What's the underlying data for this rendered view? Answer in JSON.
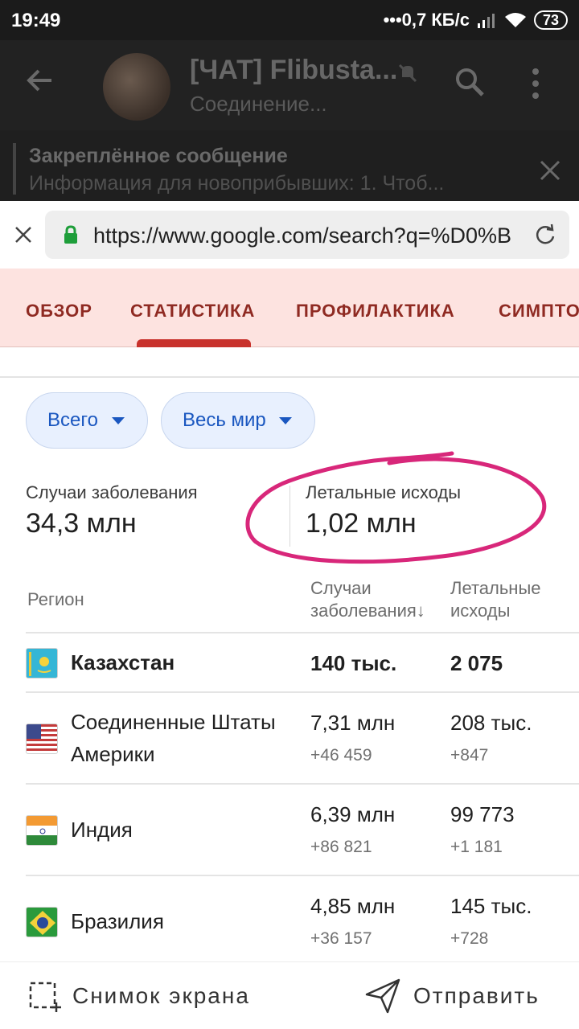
{
  "status": {
    "time": "19:49",
    "network": "•••0,7 КБ/с",
    "battery": "73"
  },
  "telegram": {
    "title": "[ЧАТ] Flibusta...",
    "subtitle": "Соединение...",
    "pinned_title": "Закреплённое сообщение",
    "pinned_text": "Информация для новоприбывших:  1. Чтоб..."
  },
  "browser": {
    "url": "https://www.google.com/search?q=%D0%B"
  },
  "tabs": [
    "ОБЗОР",
    "СТАТИСТИКА",
    "ПРОФИЛАКТИКА",
    "СИМПТОМЫ"
  ],
  "filters": {
    "scope": "Всего",
    "region": "Весь мир"
  },
  "totals": {
    "cases_label": "Случаи заболевания",
    "cases_value": "34,3 млн",
    "deaths_label": "Летальные исходы",
    "deaths_value": "1,02 млн"
  },
  "table": {
    "headers": {
      "region": "Регион",
      "cases": "Случаи заболевания↓",
      "deaths": "Летальные исходы"
    },
    "rows": [
      {
        "country": "Казахстан",
        "cases": "140 тыс.",
        "cases_delta": "",
        "deaths": "2 075",
        "deaths_delta": ""
      },
      {
        "country": "Соединенные Штаты Америки",
        "cases": "7,31 млн",
        "cases_delta": "+46 459",
        "deaths": "208 тыс.",
        "deaths_delta": "+847"
      },
      {
        "country": "Индия",
        "cases": "6,39 млн",
        "cases_delta": "+86 821",
        "deaths": "99 773",
        "deaths_delta": "+1 181"
      },
      {
        "country": "Бразилия",
        "cases": "4,85 млн",
        "cases_delta": "+36 157",
        "deaths": "145 тыс.",
        "deaths_delta": "+728"
      }
    ]
  },
  "actions": {
    "screenshot": "Снимок экрана",
    "send": "Отправить"
  },
  "colors": {
    "tab_text": "#8f2a22",
    "tab_bg": "#fde3e0",
    "chip_bg": "#e8f0fe",
    "chip_text": "#1a57c0",
    "annotation": "#d8277a"
  },
  "icons": [
    "back-arrow-icon",
    "mute-icon",
    "search-icon",
    "more-vert-icon",
    "close-icon",
    "lock-icon",
    "reload-icon",
    "dropdown-arrow-icon",
    "flag-kz-icon",
    "flag-us-icon",
    "flag-in-icon",
    "flag-br-icon",
    "screenshot-icon",
    "send-icon"
  ]
}
